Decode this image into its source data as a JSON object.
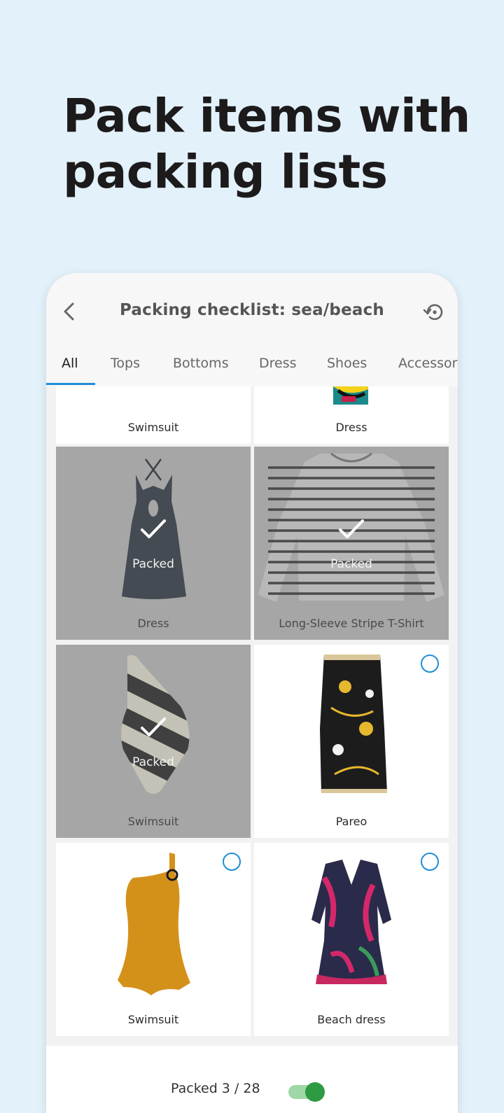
{
  "headline": "Pack items with\npacking lists",
  "appbar": {
    "title": "Packing checklist: sea/beach",
    "back_icon": "chevron-left-icon",
    "history_icon": "history-icon"
  },
  "tabs": [
    "All",
    "Tops",
    "Bottoms",
    "Dress",
    "Shoes",
    "Accessor"
  ],
  "active_tab": "All",
  "items": [
    {
      "name": "Swimsuit",
      "packed": false,
      "checkbox_visible": false
    },
    {
      "name": "Dress",
      "packed": false,
      "checkbox_visible": false
    },
    {
      "name": "Dress",
      "packed": true
    },
    {
      "name": "Long-Sleeve Stripe T-Shirt",
      "packed": true
    },
    {
      "name": "Swimsuit",
      "packed": true
    },
    {
      "name": "Pareo",
      "packed": false
    },
    {
      "name": "Swimsuit",
      "packed": false
    },
    {
      "name": "Beach dress",
      "packed": false
    }
  ],
  "packed_label": "Packed",
  "footer": {
    "packed_count": "Packed 3 / 28",
    "toggle_on": true
  },
  "colors": {
    "background": "#e3f1fa",
    "accent": "#1e8ed6",
    "packed_overlay": "#a6a6a6",
    "toggle": "#2e9b44"
  }
}
